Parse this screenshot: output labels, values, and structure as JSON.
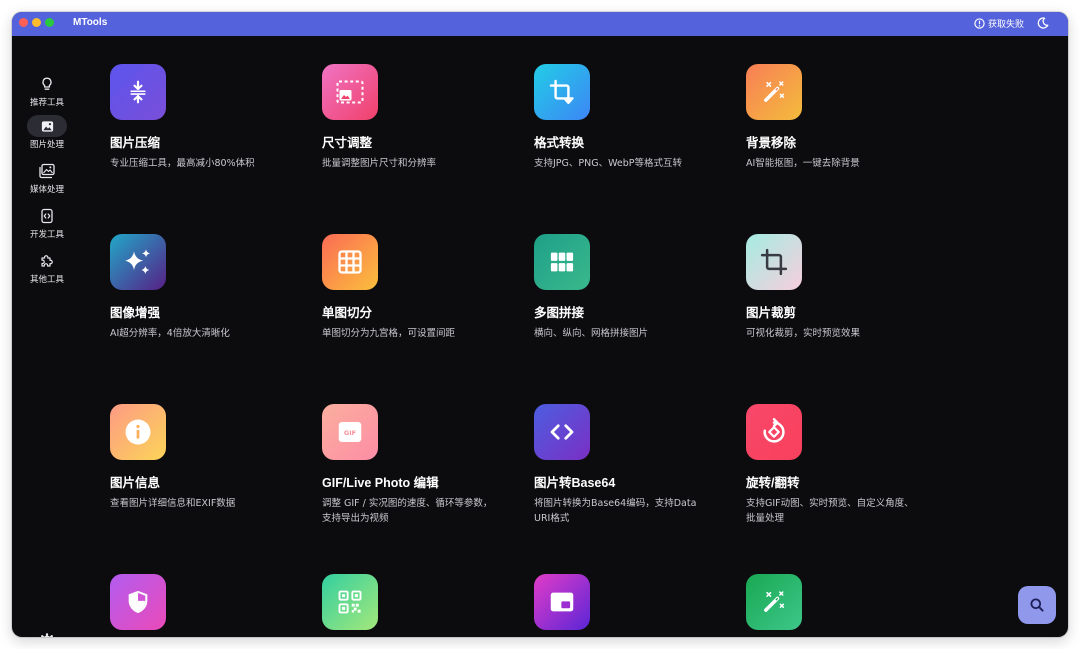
{
  "window": {
    "title": "MTools"
  },
  "titlebar": {
    "status_label": "获取失败",
    "status_icon": "alert-circle-icon",
    "theme_icon": "moon-icon"
  },
  "sidebar": {
    "items": [
      {
        "label": "推荐工具",
        "icon": "lightbulb-icon",
        "active": false
      },
      {
        "label": "图片处理",
        "icon": "image-icon",
        "active": true
      },
      {
        "label": "媒体处理",
        "icon": "gallery-icon",
        "active": false
      },
      {
        "label": "开发工具",
        "icon": "code-file-icon",
        "active": false
      },
      {
        "label": "其他工具",
        "icon": "puzzle-icon",
        "active": false
      }
    ],
    "settings_icon": "gear-icon"
  },
  "tools": [
    {
      "title": "图片压缩",
      "desc": "专业压缩工具，最高减小80%体积",
      "icon": "compress-icon",
      "colors": [
        "#5b55ee",
        "#7a4fd8"
      ]
    },
    {
      "title": "尺寸调整",
      "desc": "批量调整图片尺寸和分辨率",
      "icon": "resize-icon",
      "colors": [
        "#f074c4",
        "#f0406a"
      ]
    },
    {
      "title": "格式转换",
      "desc": "支持JPG、PNG、WebP等格式互转",
      "icon": "crop-convert-icon",
      "colors": [
        "#22cde6",
        "#3d86f5"
      ]
    },
    {
      "title": "背景移除",
      "desc": "AI智能抠图，一键去除背景",
      "icon": "magic-wand-icon",
      "colors": [
        "#f87e56",
        "#f4bc3c"
      ]
    },
    {
      "title": "图像增强",
      "desc": "AI超分辨率，4倍放大清晰化",
      "icon": "sparkles-icon",
      "colors": [
        "#21a8c8",
        "#571f86"
      ]
    },
    {
      "title": "单图切分",
      "desc": "单图切分为九宫格，可设置间距",
      "icon": "grid-icon",
      "colors": [
        "#fb6b55",
        "#fbbf3c"
      ]
    },
    {
      "title": "多图拼接",
      "desc": "横向、纵向、网格拼接图片",
      "icon": "collage-icon",
      "colors": [
        "#1ea089",
        "#3ab88b"
      ]
    },
    {
      "title": "图片裁剪",
      "desc": "可视化裁剪，实时预览效果",
      "icon": "crop-icon",
      "colors": [
        "#a4ece2",
        "#f7cedc"
      ]
    },
    {
      "title": "图片信息",
      "desc": "查看图片详细信息和EXIF数据",
      "icon": "info-icon",
      "colors": [
        "#fd9a84",
        "#fcd558"
      ]
    },
    {
      "title": "GIF/Live Photo 编辑",
      "desc": "调整 GIF / 实况图的速度、循环等参数，支持导出为视频",
      "icon": "gif-icon",
      "gif_text": "GIF",
      "colors": [
        "#fbaf9e",
        "#fc8da5"
      ]
    },
    {
      "title": "图片转Base64",
      "desc": "将图片转换为Base64编码，支持Data URI格式",
      "icon": "code-icon",
      "colors": [
        "#4c5ee0",
        "#7b2fc4"
      ]
    },
    {
      "title": "旋转/翻转",
      "desc": "支持GIF动图、实时预览、自定义角度、批量处理",
      "icon": "rotate-icon",
      "colors": [
        "#f8486a",
        "#f8405c"
      ]
    },
    {
      "title": "",
      "desc": "",
      "icon": "shield-icon",
      "colors": [
        "#b25cf0",
        "#ea4ab8"
      ]
    },
    {
      "title": "",
      "desc": "",
      "icon": "qr-code-icon",
      "colors": [
        "#33cfa0",
        "#a4e87a"
      ]
    },
    {
      "title": "",
      "desc": "",
      "icon": "picture-in-picture-icon",
      "colors": [
        "#e23cc8",
        "#5a26d6"
      ]
    },
    {
      "title": "",
      "desc": "",
      "icon": "magic-wand-icon",
      "colors": [
        "#18a852",
        "#3ec78a"
      ]
    }
  ],
  "fab": {
    "icon": "search-icon"
  }
}
